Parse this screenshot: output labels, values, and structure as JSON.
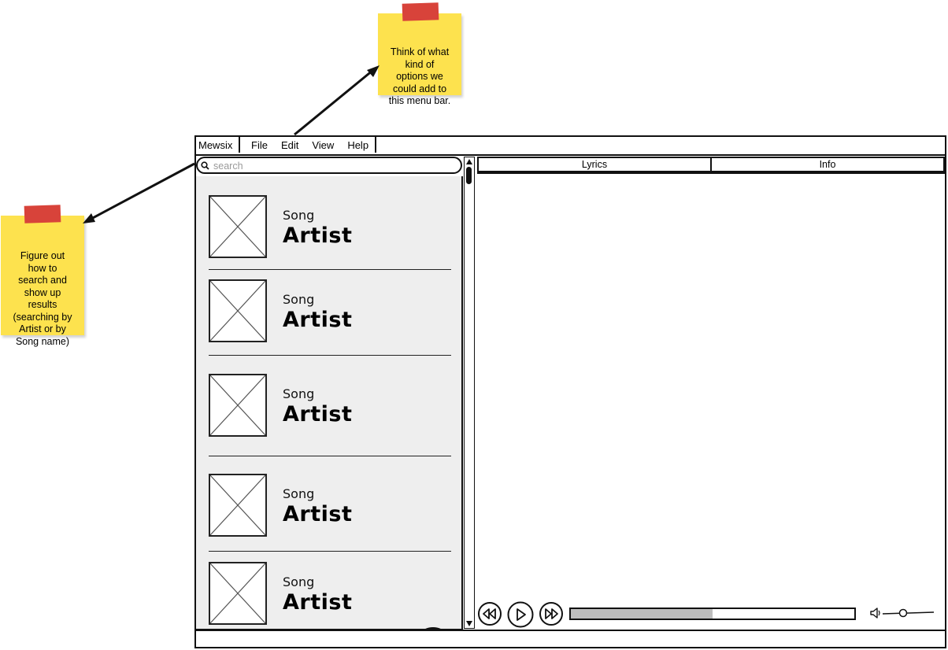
{
  "notes": {
    "menu_note": "Think of what\nkind of\noptions we\ncould add to\nthis menu bar.",
    "search_note": "Figure out\nhow to\nsearch and\nshow up\nresults\n(searching by\nArtist or by\nSong name)"
  },
  "app": {
    "name": "Mewsix",
    "menu": [
      "File",
      "Edit",
      "View",
      "Help"
    ]
  },
  "search": {
    "placeholder": "search",
    "value": ""
  },
  "songs": [
    {
      "song": "Song",
      "artist": "Artist"
    },
    {
      "song": "Song",
      "artist": "Artist"
    },
    {
      "song": "Song",
      "artist": "Artist"
    },
    {
      "song": "Song",
      "artist": "Artist"
    },
    {
      "song": "Song",
      "artist": "Artist"
    }
  ],
  "add_button": "+",
  "tabs": [
    "Lyrics",
    "Info"
  ],
  "player": {
    "progress": 0.5,
    "volume": 0.4,
    "icons": [
      "rewind-icon",
      "play-icon",
      "fast-forward-icon",
      "speaker-icon"
    ]
  },
  "colors": {
    "sticky": "#fde24e",
    "tape": "#d8433a",
    "list_bg": "#eeeeee",
    "progress_fill": "#bdbdbd"
  }
}
